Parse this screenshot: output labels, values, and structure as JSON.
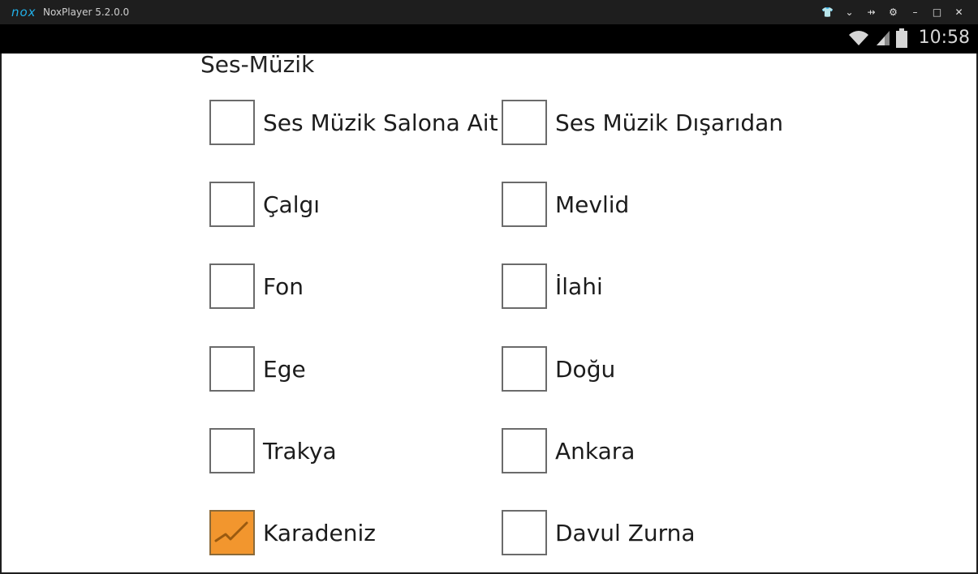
{
  "window": {
    "logo": "nox",
    "title": "NoxPlayer 5.2.0.0",
    "controls": [
      {
        "name": "shirt-icon",
        "glyph": "👕"
      },
      {
        "name": "chevron-down-icon",
        "glyph": "⌄"
      },
      {
        "name": "pin-icon",
        "glyph": "⇸"
      },
      {
        "name": "gear-icon",
        "glyph": "⚙"
      },
      {
        "name": "minimize-icon",
        "glyph": "–"
      },
      {
        "name": "maximize-icon",
        "glyph": "□"
      },
      {
        "name": "close-icon",
        "glyph": "✕"
      }
    ]
  },
  "statusbar": {
    "time": "10:58",
    "icons": [
      "wifi-icon",
      "signal-icon",
      "battery-icon"
    ]
  },
  "section": {
    "title": "Ses-Müzik"
  },
  "options": {
    "left": [
      {
        "label": "Ses Müzik Salona Ait",
        "checked": false
      },
      {
        "label": "Çalgı",
        "checked": false
      },
      {
        "label": "Fon",
        "checked": false
      },
      {
        "label": "Ege",
        "checked": false
      },
      {
        "label": "Trakya",
        "checked": false
      },
      {
        "label": "Karadeniz",
        "checked": true
      }
    ],
    "right": [
      {
        "label": "Ses Müzik Dışarıdan",
        "checked": false
      },
      {
        "label": "Mevlid",
        "checked": false
      },
      {
        "label": "İlahi",
        "checked": false
      },
      {
        "label": "Doğu",
        "checked": false
      },
      {
        "label": "Ankara",
        "checked": false
      },
      {
        "label": "Davul Zurna",
        "checked": false
      }
    ]
  },
  "colors": {
    "checked_fill": "#f2962e",
    "box_border": "#6b6b6b",
    "accent": "#22b0e8"
  }
}
